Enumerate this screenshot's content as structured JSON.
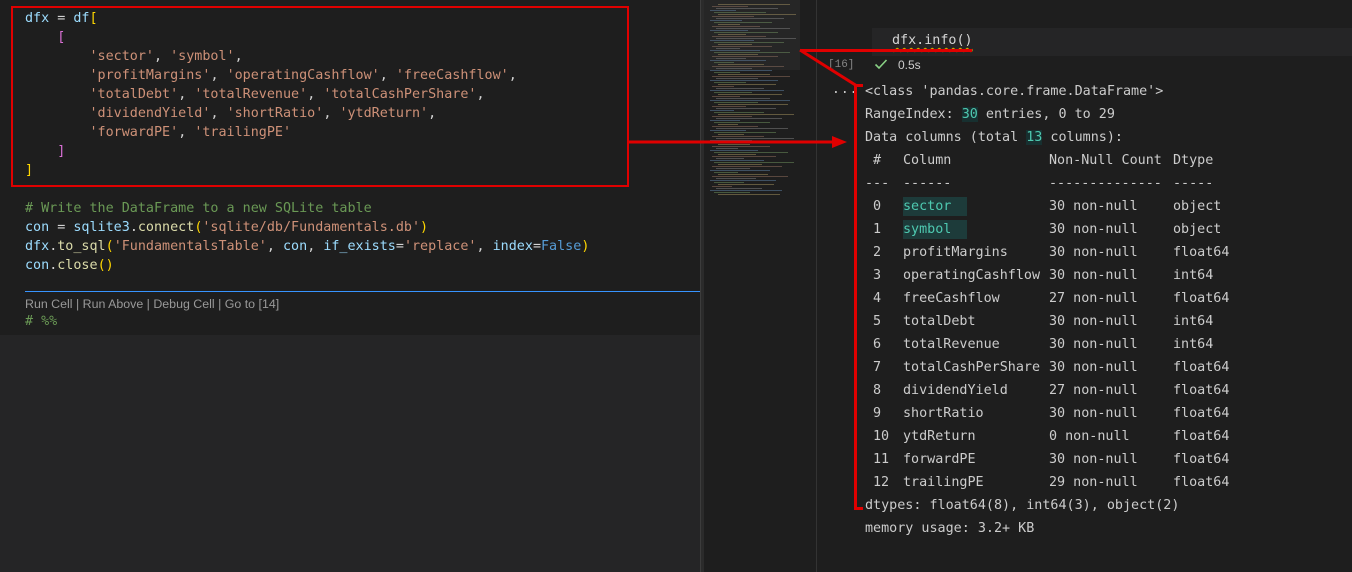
{
  "editor": {
    "code_lines": [
      [
        {
          "t": "var",
          "s": "dfx"
        },
        {
          "t": "p",
          "s": " = "
        },
        {
          "t": "var",
          "s": "df"
        },
        {
          "t": "br",
          "s": "["
        }
      ],
      [
        {
          "t": "p",
          "s": "    "
        },
        {
          "t": "br2",
          "s": "["
        }
      ],
      [
        {
          "t": "p",
          "s": "        "
        },
        {
          "t": "str",
          "s": "'sector'"
        },
        {
          "t": "p",
          "s": ", "
        },
        {
          "t": "str",
          "s": "'symbol'"
        },
        {
          "t": "p",
          "s": ","
        }
      ],
      [
        {
          "t": "p",
          "s": "        "
        },
        {
          "t": "str",
          "s": "'profitMargins'"
        },
        {
          "t": "p",
          "s": ", "
        },
        {
          "t": "str",
          "s": "'operatingCashflow'"
        },
        {
          "t": "p",
          "s": ", "
        },
        {
          "t": "str",
          "s": "'freeCashflow'"
        },
        {
          "t": "p",
          "s": ","
        }
      ],
      [
        {
          "t": "p",
          "s": "        "
        },
        {
          "t": "str",
          "s": "'totalDebt'"
        },
        {
          "t": "p",
          "s": ", "
        },
        {
          "t": "str",
          "s": "'totalRevenue'"
        },
        {
          "t": "p",
          "s": ", "
        },
        {
          "t": "str",
          "s": "'totalCashPerShare'"
        },
        {
          "t": "p",
          "s": ","
        }
      ],
      [
        {
          "t": "p",
          "s": "        "
        },
        {
          "t": "str",
          "s": "'dividendYield'"
        },
        {
          "t": "p",
          "s": ", "
        },
        {
          "t": "str",
          "s": "'shortRatio'"
        },
        {
          "t": "p",
          "s": ", "
        },
        {
          "t": "str",
          "s": "'ytdReturn'"
        },
        {
          "t": "p",
          "s": ","
        }
      ],
      [
        {
          "t": "p",
          "s": "        "
        },
        {
          "t": "str",
          "s": "'forwardPE'"
        },
        {
          "t": "p",
          "s": ", "
        },
        {
          "t": "str",
          "s": "'trailingPE'"
        }
      ],
      [
        {
          "t": "p",
          "s": "    "
        },
        {
          "t": "br2",
          "s": "]"
        }
      ],
      [
        {
          "t": "br",
          "s": "]"
        }
      ],
      [],
      [
        {
          "t": "cm",
          "s": "# Write the DataFrame to a new SQLite table"
        }
      ],
      [
        {
          "t": "var",
          "s": "con"
        },
        {
          "t": "p",
          "s": " = "
        },
        {
          "t": "var",
          "s": "sqlite3"
        },
        {
          "t": "p",
          "s": "."
        },
        {
          "t": "fn",
          "s": "connect"
        },
        {
          "t": "br",
          "s": "("
        },
        {
          "t": "str",
          "s": "'sqlite/db/Fundamentals.db'"
        },
        {
          "t": "br",
          "s": ")"
        }
      ],
      [
        {
          "t": "var",
          "s": "dfx"
        },
        {
          "t": "p",
          "s": "."
        },
        {
          "t": "fn",
          "s": "to_sql"
        },
        {
          "t": "br",
          "s": "("
        },
        {
          "t": "str",
          "s": "'FundamentalsTable'"
        },
        {
          "t": "p",
          "s": ", "
        },
        {
          "t": "var",
          "s": "con"
        },
        {
          "t": "p",
          "s": ", "
        },
        {
          "t": "var",
          "s": "if_exists"
        },
        {
          "t": "p",
          "s": "="
        },
        {
          "t": "str",
          "s": "'replace'"
        },
        {
          "t": "p",
          "s": ", "
        },
        {
          "t": "var",
          "s": "index"
        },
        {
          "t": "p",
          "s": "="
        },
        {
          "t": "kw",
          "s": "False"
        },
        {
          "t": "br",
          "s": ")"
        }
      ],
      [
        {
          "t": "var",
          "s": "con"
        },
        {
          "t": "p",
          "s": "."
        },
        {
          "t": "fn",
          "s": "close"
        },
        {
          "t": "br",
          "s": "()"
        }
      ]
    ],
    "codelens": "Run Cell | Run Above | Debug Cell | Go to [14]",
    "cell_marker": "# %%"
  },
  "interactive": {
    "input_code": "dfx.info()",
    "exec_count": "[16]",
    "duration": "0.5s",
    "output_menu": "...",
    "output_header": [
      "<class 'pandas.core.frame.DataFrame'>"
    ],
    "range_prefix": "RangeIndex: ",
    "range_count": "30",
    "range_suffix": " entries, 0 to 29",
    "cols_prefix": "Data columns (total ",
    "cols_count": "13",
    "cols_suffix": " columns):",
    "table_header": {
      "num": " #",
      "col": "Column",
      "nn": "Non-Null Count",
      "dt": "Dtype"
    },
    "table_rule": {
      "num": "---",
      "col": "------",
      "nn": "--------------",
      "dt": "-----"
    },
    "rows": [
      {
        "i": "0",
        "c": "sector",
        "n": "30 non-null",
        "d": "object"
      },
      {
        "i": "1",
        "c": "symbol",
        "n": "30 non-null",
        "d": "object"
      },
      {
        "i": "2",
        "c": "profitMargins",
        "n": "30 non-null",
        "d": "float64"
      },
      {
        "i": "3",
        "c": "operatingCashflow",
        "n": "30 non-null",
        "d": "int64"
      },
      {
        "i": "4",
        "c": "freeCashflow",
        "n": "27 non-null",
        "d": "float64"
      },
      {
        "i": "5",
        "c": "totalDebt",
        "n": "30 non-null",
        "d": "int64"
      },
      {
        "i": "6",
        "c": "totalRevenue",
        "n": "30 non-null",
        "d": "int64"
      },
      {
        "i": "7",
        "c": "totalCashPerShare",
        "n": "30 non-null",
        "d": "float64"
      },
      {
        "i": "8",
        "c": "dividendYield",
        "n": "27 non-null",
        "d": "float64"
      },
      {
        "i": "9",
        "c": "shortRatio",
        "n": "30 non-null",
        "d": "float64"
      },
      {
        "i": "10",
        "c": "ytdReturn",
        "n": "0 non-null",
        "d": "float64"
      },
      {
        "i": "11",
        "c": "forwardPE",
        "n": "30 non-null",
        "d": "float64"
      },
      {
        "i": "12",
        "c": "trailingPE",
        "n": "29 non-null",
        "d": "float64"
      }
    ],
    "dtypes_line": "dtypes: float64(8), int64(3), object(2)",
    "memory_line": "memory usage: 3.2+ KB"
  },
  "colors": {
    "accent_red": "#e00000",
    "success_green": "#89d185",
    "cell_separator_blue": "#3794ff"
  }
}
